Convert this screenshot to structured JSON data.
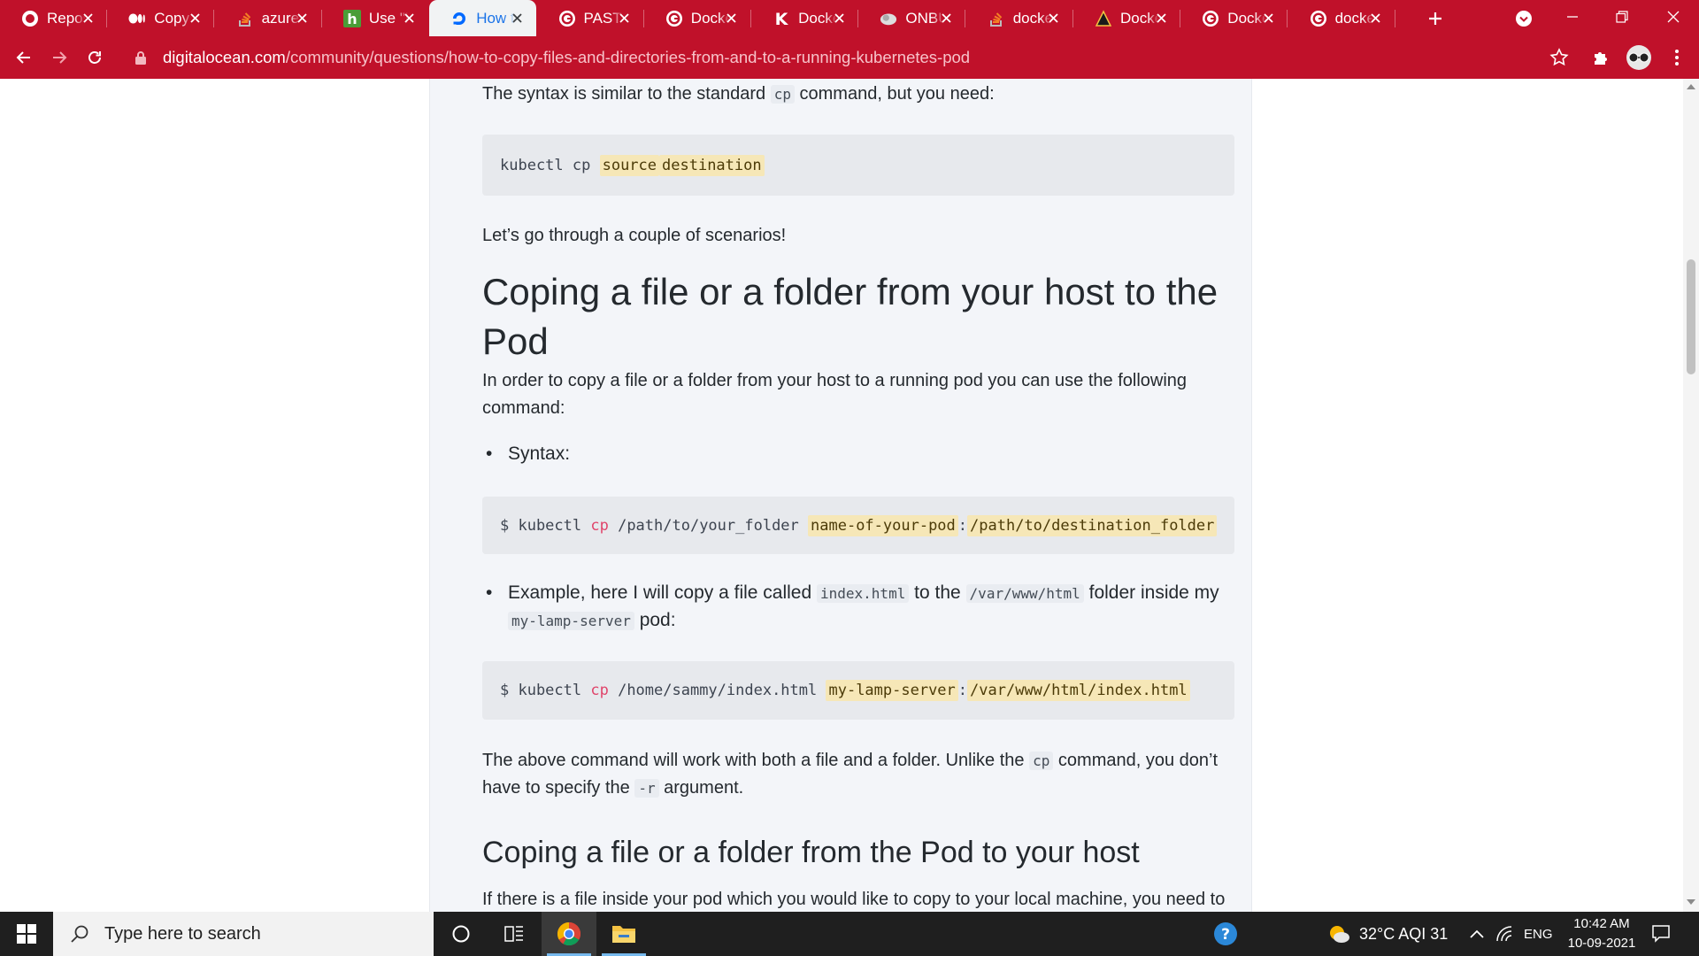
{
  "browser": {
    "tabs": [
      {
        "title": "Repository",
        "icon": "github-icon",
        "active": false
      },
      {
        "title": "Copy files",
        "icon": "medium-icon",
        "active": false
      },
      {
        "title": "azure",
        "icon": "stackoverflow-icon",
        "active": false
      },
      {
        "title": "Use \"kubectl\"",
        "icon": "h-icon",
        "active": false
      },
      {
        "title": "How to",
        "icon": "digitalocean-icon",
        "active": true
      },
      {
        "title": "PASTE",
        "icon": "google-icon",
        "active": false
      },
      {
        "title": "Docker",
        "icon": "google-icon",
        "active": false
      },
      {
        "title": "Docker",
        "icon": "k-icon",
        "active": false
      },
      {
        "title": "ONBUILD",
        "icon": "cloud-icon",
        "active": false
      },
      {
        "title": "docker",
        "icon": "stackoverflow-icon",
        "active": false
      },
      {
        "title": "Docker",
        "icon": "triangle-icon",
        "active": false
      },
      {
        "title": "Docker",
        "icon": "google-icon",
        "active": false
      },
      {
        "title": "docker",
        "icon": "google-icon",
        "active": false
      }
    ],
    "url_host": "digitalocean.com",
    "url_path": "/community/questions/how-to-copy-files-and-directories-from-and-to-a-running-kubernetes-pod",
    "accent_color": "#c0112a"
  },
  "article": {
    "p_syntax": {
      "before": "The syntax is similar to the standard ",
      "code": "cp",
      "after": " command, but you need:"
    },
    "code_basic": {
      "cmd": "kubectl cp ",
      "arg1": "source",
      "arg2": "destination"
    },
    "p_scenarios": "Let’s go through a couple of scenarios!",
    "h2_host_to_pod": "Coping a file or a folder from your host to the Pod",
    "p_intro": "In order to copy a file or a folder from your host to a running pod you can use the following command:",
    "bullet_syntax": "Syntax:",
    "code_syntax": {
      "prompt": "$ kubectl ",
      "kw": "cp",
      "src": " /path/to/your_folder ",
      "pod": "name-of-your-pod",
      "colon": ":",
      "dest": "/path/to/destination_folder"
    },
    "bullet_example": {
      "t1": "Example, here I will copy a file called ",
      "c1": "index.html",
      "t2": " to the ",
      "c2": "/var/www/html",
      "t3": " folder inside my ",
      "c3": "my-lamp-server",
      "t4": " pod:"
    },
    "code_example": {
      "prompt": "$ kubectl ",
      "kw": "cp",
      "src": " /home/sammy/index.html ",
      "pod": "my-lamp-server",
      "colon": ":",
      "dest": "/var/www/html/index.html"
    },
    "p_above": {
      "t1": "The above command will work with both a file and a folder. Unlike the ",
      "c1": "cp",
      "t2": " command, you don’t have to specify the ",
      "c2": "-r",
      "t3": " argument."
    },
    "h3_pod_to_host": "Coping a file or a folder from the Pod to your host",
    "p_cutoff": "If there is a file inside your pod which you would like to copy to your local machine, you need to"
  },
  "taskbar": {
    "search_placeholder": "Type here to search",
    "weather": "32°C  AQI 31",
    "language": "ENG",
    "time": "10:42 AM",
    "date": "10-09-2021"
  }
}
